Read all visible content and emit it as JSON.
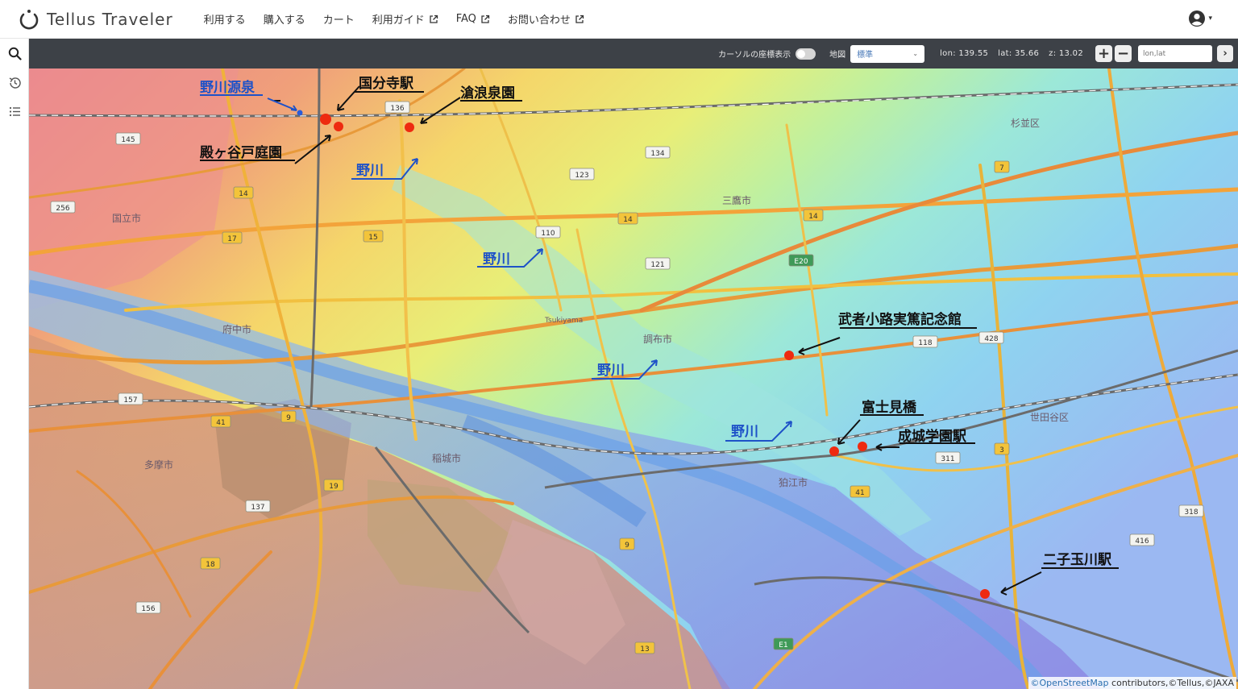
{
  "navbar": {
    "brand": "Tellus Traveler",
    "menu": [
      {
        "label": "利用する",
        "external": false
      },
      {
        "label": "購入する",
        "external": false
      },
      {
        "label": "カート",
        "external": false
      },
      {
        "label": "利用ガイド",
        "external": true
      },
      {
        "label": "FAQ",
        "external": true
      },
      {
        "label": "お問い合わせ",
        "external": true
      }
    ]
  },
  "sidebar": {
    "icons": [
      "search-icon",
      "history-icon",
      "list-icon"
    ]
  },
  "toolbar": {
    "cursor_label": "カーソルの座標表示",
    "map_label": "地図",
    "map_select": "標準",
    "lon": "lon: 139.55",
    "lat": "lat: 35.66",
    "zoom": "z: 13.02",
    "coord_placeholder": "lon,lat"
  },
  "map": {
    "annotations": {
      "nogawa_source": "野川源泉",
      "kokubunji": "国分寺駅",
      "soroizumi": "滄浪泉園",
      "tonogayato": "殿ヶ谷戸庭園",
      "nogawa_1": "野川",
      "nogawa_2": "野川",
      "nogawa_3": "野川",
      "nogawa_4": "野川",
      "mushanokoji": "武者小路実篤記念館",
      "fujimibashi": "富士見橋",
      "seijo": "成城学園駅",
      "futakotamagawa": "二子玉川駅"
    },
    "place_names": {
      "kunitachi": "国立市",
      "fuchu": "府中市",
      "chofu": "調布市",
      "komae": "狛江市",
      "inagi": "稲城市",
      "tama": "多摩市",
      "mitaka": "三鷹市",
      "setagaya": "世田谷区",
      "suginami": "杉並区",
      "tsukiyama": "Tsukiyama"
    },
    "route_shields": [
      "136",
      "145",
      "134",
      "123",
      "7",
      "14",
      "256",
      "15",
      "17",
      "110",
      "14",
      "14",
      "E20",
      "121",
      "118",
      "428",
      "157",
      "41",
      "9",
      "19",
      "137",
      "3",
      "311",
      "41",
      "318",
      "416",
      "9",
      "18",
      "156",
      "13",
      "E1"
    ],
    "attribution_osm": "©OpenStreetMap",
    "attribution_rest": " contributors,©Tellus,©JAXA"
  },
  "colors": {
    "toolbar": "#3d4147",
    "marker": "#ee2a10",
    "label_blue": "#1e52c8"
  }
}
